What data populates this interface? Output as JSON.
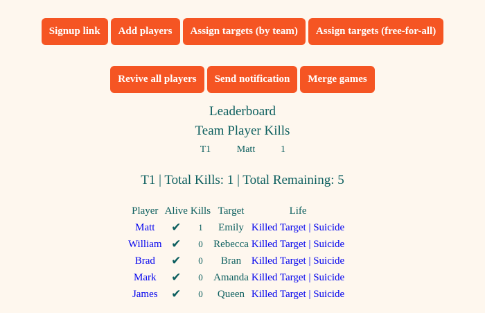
{
  "buttons_row1": [
    "Signup link",
    "Add players",
    "Assign targets (by team)",
    "Assign targets (free-for-all)"
  ],
  "buttons_row2": [
    "Revive all players",
    "Send notification",
    "Merge games"
  ],
  "leaderboard": {
    "title": "Leaderboard",
    "subtitle": "Team Player Kills",
    "top": {
      "team": "T1",
      "player": "Matt",
      "kills": "1"
    }
  },
  "team_summary": "T1 | Total Kills: 1 | Total Remaining: 5",
  "table": {
    "headers": [
      "Player",
      "Alive",
      "Kills",
      "Target",
      "Life"
    ],
    "alive_icon": "check-mark-icon",
    "rows": [
      {
        "player": "Matt",
        "alive": "✔",
        "kills": "1",
        "target": "Emily",
        "killed": "Killed Target",
        "sep": "|",
        "suicide": "Suicide"
      },
      {
        "player": "William",
        "alive": "✔",
        "kills": "0",
        "target": "Rebecca",
        "killed": "Killed Target",
        "sep": "|",
        "suicide": "Suicide"
      },
      {
        "player": "Brad",
        "alive": "✔",
        "kills": "0",
        "target": "Bran",
        "killed": "Killed Target",
        "sep": "|",
        "suicide": "Suicide"
      },
      {
        "player": "Mark",
        "alive": "✔",
        "kills": "0",
        "target": "Amanda",
        "killed": "Killed Target",
        "sep": "|",
        "suicide": "Suicide"
      },
      {
        "player": "James",
        "alive": "✔",
        "kills": "0",
        "target": "Queen",
        "killed": "Killed Target",
        "sep": "|",
        "suicide": "Suicide"
      }
    ]
  },
  "colors": {
    "background": "#fef7ee",
    "button": "#f55523",
    "text": "#0b5e5e",
    "link": "#0000ee"
  }
}
